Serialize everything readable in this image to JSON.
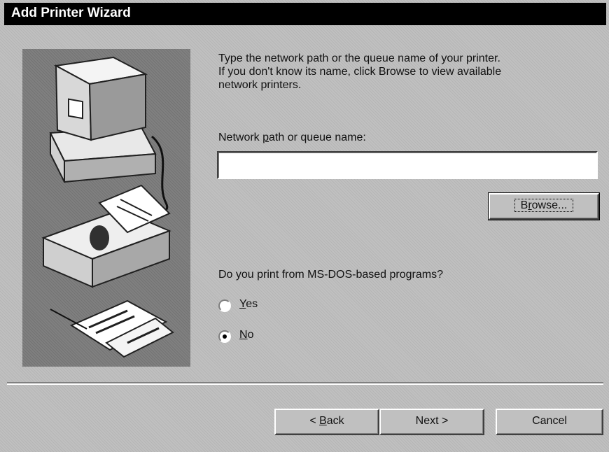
{
  "window": {
    "title": "Add Printer Wizard"
  },
  "content": {
    "intro": "Type the network path or the queue name of your printer.\nIf you don't know its name, click Browse to view available\nnetwork printers.",
    "field_label_pre": "Network ",
    "field_label_accel": "p",
    "field_label_post": "ath or queue name:",
    "path_value": "",
    "question": "Do you print from MS-DOS-based programs?"
  },
  "buttons": {
    "browse_accel": "r",
    "browse_pre": "B",
    "browse_post": "owse...",
    "back_pre": "< ",
    "back_accel": "B",
    "back_post": "ack",
    "next": "Next >",
    "cancel": "Cancel"
  },
  "radios": {
    "yes_accel": "Y",
    "yes_post": "es",
    "no_accel": "N",
    "no_post": "o",
    "selected": "No"
  },
  "colors": {
    "titlebar": "#000000",
    "face": "#c0c0c0",
    "art_bg": "#808080"
  }
}
